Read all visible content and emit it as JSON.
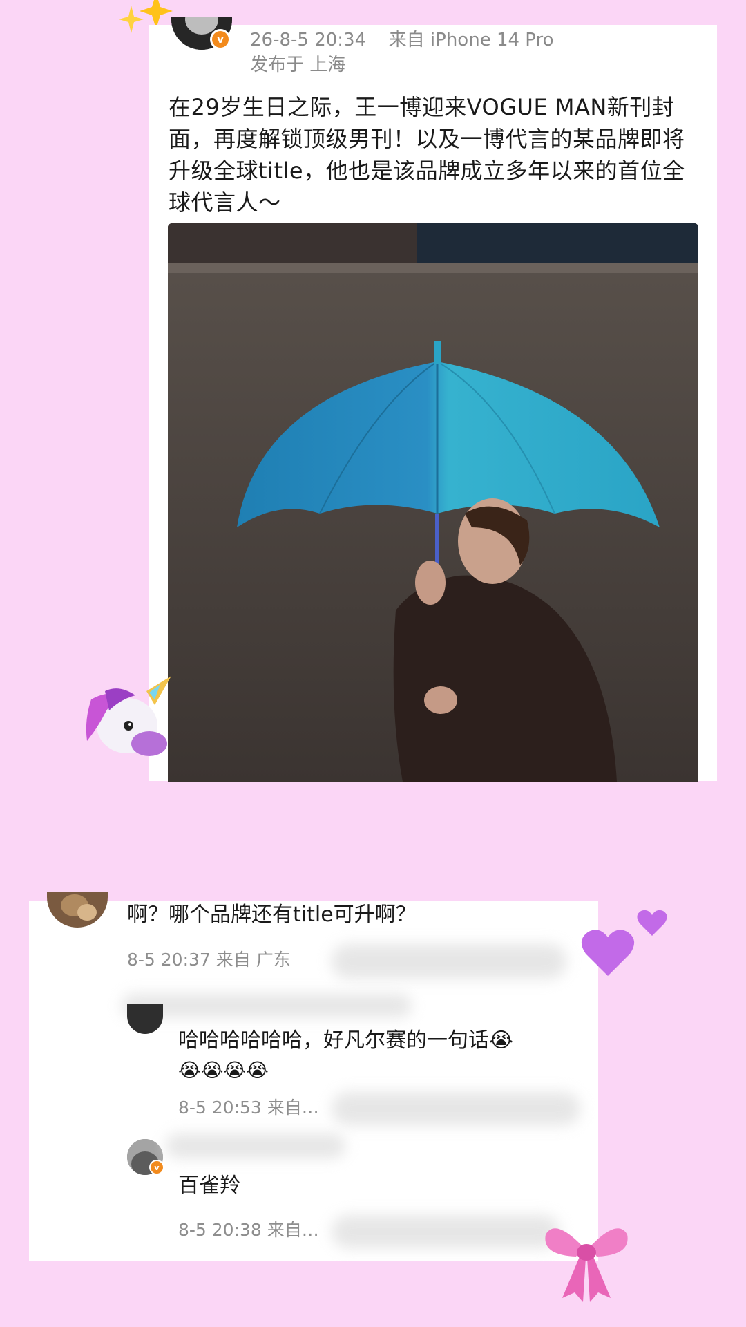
{
  "post": {
    "timestamp": "26-8-5 20:34",
    "source": "来自 iPhone 14 Pro",
    "location": "发布于 上海",
    "text": "在29岁生日之际，王一博迎来VOGUE MAN新刊封面，再度解锁顶级男刊！以及一博代言的某品牌即将升级全球title，他也是该品牌成立多年以来的首位全球代言人～",
    "verified_badge": "v",
    "photo_icon": "umbrella-portrait-photo",
    "colors": {
      "umbrella": "#2fa6c9",
      "background": "#4a4440"
    }
  },
  "comments": {
    "main": {
      "text": "啊？哪个品牌还有title可升啊？",
      "meta": "8-5 20:37  来自 广东"
    },
    "replies": [
      {
        "text_line1": "哈哈哈哈哈哈，好凡尔赛的一句话",
        "emoji_line1": "😭",
        "text_line2": "😭😭😭😭",
        "meta": "8-5 20:53  来自…"
      },
      {
        "text": "百雀羚",
        "meta": "8-5 20:38  来自…",
        "verified_badge": "v"
      }
    ]
  },
  "stickers": {
    "sparkle": "✨",
    "unicorn": "🦄",
    "hearts": "💜",
    "bow": "🎀"
  }
}
